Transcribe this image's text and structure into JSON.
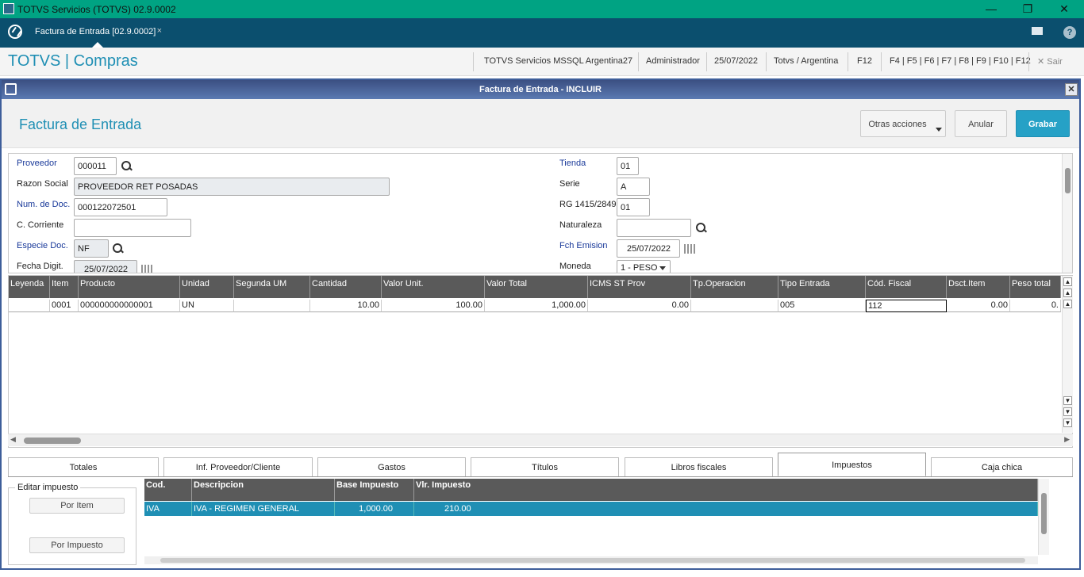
{
  "window": {
    "title": "TOTVS Servicios (TOTVS) 02.9.0002",
    "minimize": "—",
    "maximize": "❐",
    "close": "✕"
  },
  "tabbar": {
    "tab_label": "Factura de Entrada [02.9.0002]",
    "tab_close": "×",
    "help": "?"
  },
  "brandbar": {
    "brand": "TOTVS | Compras",
    "server": "TOTVS Servicios MSSQL Argentina27",
    "user": "Administrador",
    "date": "25/07/2022",
    "company": "Totvs / Argentina",
    "f12": "F12",
    "shortcuts": "F4 | F5 | F6 | F7 | F8 | F9 | F10 | F12",
    "exit": "✕  Sair"
  },
  "dialog": {
    "title": "Factura de Entrada - INCLUIR",
    "close": "✕",
    "heading": "Factura de Entrada",
    "btn_more": "Otras acciones",
    "btn_cancel": "Anular",
    "btn_save": "Grabar"
  },
  "form": {
    "proveedor_label": "Proveedor",
    "proveedor": "000011",
    "razon_label": "Razon Social",
    "razon": "PROVEEDOR RET POSADAS",
    "numdoc_label": "Num. de Doc.",
    "numdoc": "000122072501",
    "ccorr_label": "C. Corriente",
    "ccorr": "",
    "especie_label": "Especie Doc.",
    "especie": "NF",
    "fdigit_label": "Fecha Digit.",
    "fdigit": "25/07/2022",
    "tienda_label": "Tienda",
    "tienda": "01",
    "serie_label": "Serie",
    "serie": "A",
    "rg_label": "RG 1415/2849",
    "rg": "01",
    "naturaleza_label": "Naturaleza",
    "naturaleza": "",
    "femision_label": "Fch Emision",
    "femision": "25/07/2022",
    "moneda_label": "Moneda",
    "moneda": "1 - PESO"
  },
  "grid": {
    "headers": [
      "Leyenda",
      "Item",
      "Producto",
      "Unidad",
      "Segunda UM",
      "Cantidad",
      "Valor Unit.",
      "Valor Total",
      "ICMS ST Prov",
      "Tp.Operacion",
      "Tipo Entrada",
      "Cód. Fiscal",
      "Dsct.Item",
      "Peso total"
    ],
    "rows": [
      [
        "",
        "0001",
        "000000000000001",
        "UN",
        "",
        "10.00",
        "100.00",
        "1,000.00",
        "0.00",
        "",
        "005",
        "112",
        "0.00",
        "0."
      ]
    ]
  },
  "tabs": [
    "Totales",
    "Inf. Proveedor/Cliente",
    "Gastos",
    "Títulos",
    "Libros fiscales",
    "Impuestos",
    "Caja chica"
  ],
  "edit": {
    "legend": "Editar impuesto",
    "by_item": "Por Item",
    "by_tax": "Por Impuesto"
  },
  "tax": {
    "headers": [
      "Cod.",
      "Descripcion",
      "Base Impuesto",
      "Vlr. Impuesto"
    ],
    "rows": [
      [
        "IVA",
        "IVA - REGIMEN GENERAL",
        "1,000.00",
        "210.00"
      ]
    ]
  }
}
